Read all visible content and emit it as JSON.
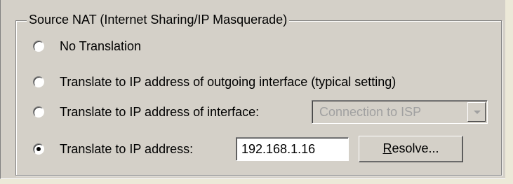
{
  "group": {
    "title": "Source NAT (Internet Sharing/IP Masquerade)"
  },
  "options": [
    {
      "label": "No Translation",
      "checked": false
    },
    {
      "label": "Translate to IP address of outgoing interface (typical setting)",
      "checked": false
    },
    {
      "label": "Translate to IP address of interface:",
      "checked": false
    },
    {
      "label": "Translate to IP address:",
      "checked": true
    }
  ],
  "interface_select": {
    "value": "Connection to ISP",
    "enabled": false
  },
  "ip_address": {
    "value": "192.168.1.16"
  },
  "resolve_button": {
    "mnemonic": "R",
    "rest": "esolve..."
  }
}
